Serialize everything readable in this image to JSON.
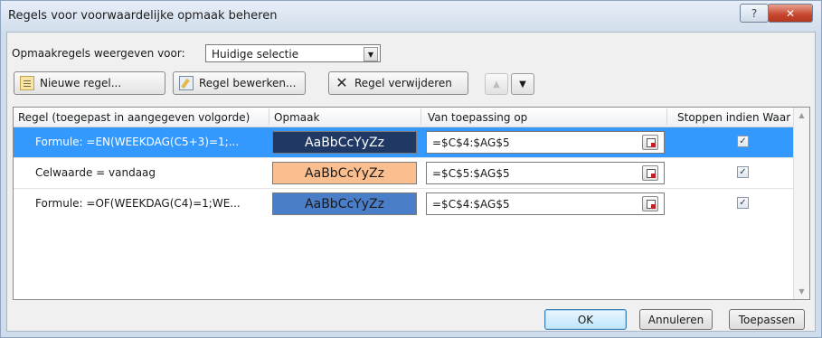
{
  "window": {
    "title": "Regels voor voorwaardelijke opmaak beheren",
    "help_label": "?",
    "close_label": "✕"
  },
  "show_rules": {
    "label": "Opmaakregels weergeven voor:",
    "value": "Huidige selectie"
  },
  "toolbar": {
    "new_rule": "Nieuwe regel...",
    "edit_rule": "Regel bewerken...",
    "delete_rule": "Regel verwijderen"
  },
  "table": {
    "headers": [
      "Regel (toegepast in aangegeven volgorde)",
      "Opmaak",
      "Van toepassing op",
      "Stoppen indien Waar"
    ],
    "rows": [
      {
        "rule": "Formule: =EN(WEEKDAG(C5+3)=1;...",
        "preview": "AaBbCcYyZz",
        "fill": "#1f3864",
        "text_color": "#ffffff",
        "applies_to": "=$C$4:$AG$5",
        "stop": true,
        "selected": true
      },
      {
        "rule": "Celwaarde = vandaag",
        "preview": "AaBbCcYyZz",
        "fill": "#fbbf8f",
        "text_color": "#1a1a1a",
        "applies_to": "=$C$5:$AG$5",
        "stop": true,
        "selected": false
      },
      {
        "rule": "Formule: =OF(WEEKDAG(C4)=1;WE...",
        "preview": "AaBbCcYyZz",
        "fill": "#4a7ec9",
        "text_color": "#1a1a1a",
        "applies_to": "=$C$4:$AG$5",
        "stop": true,
        "selected": false
      }
    ]
  },
  "buttons": {
    "ok": "OK",
    "cancel": "Annuleren",
    "apply": "Toepassen"
  },
  "colors": {
    "selection": "#3399ff",
    "title_bg": "#dce6f2",
    "close": "#c7452e"
  }
}
